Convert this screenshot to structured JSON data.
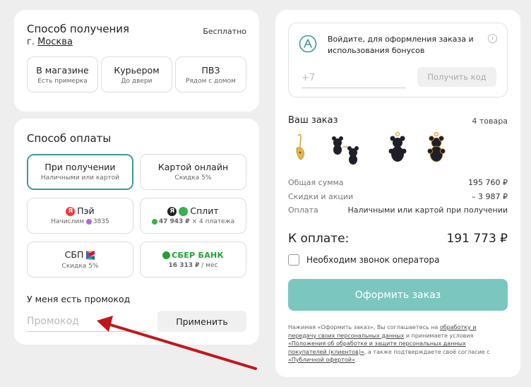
{
  "delivery": {
    "title": "Способ получения",
    "city_prefix": "г.",
    "city": "Москва",
    "price": "Бесплатно",
    "options": [
      {
        "title": "В магазине",
        "sub": "Есть примерка"
      },
      {
        "title": "Курьером",
        "sub": "До двери"
      },
      {
        "title": "ПВЗ",
        "sub": "Рядом с домом"
      }
    ]
  },
  "payment": {
    "title": "Способ оплаты",
    "on_receipt": {
      "title": "При получении",
      "sub": "Наличными или картой"
    },
    "card_online": {
      "title": "Картой онлайн",
      "sub": "Скидка 5%"
    },
    "yapay": {
      "title": "Пэй",
      "sub_prefix": "Начислим",
      "sub_value": "3835"
    },
    "split": {
      "title": "Сплит",
      "sub_value": "47 943 ₽",
      "sub_suffix": "× 4 платежа"
    },
    "sbp": {
      "title": "СБП",
      "sub": "Скидка 5%"
    },
    "sber": {
      "title": "СБЕР БАНК",
      "sub_value": "16 313 ₽",
      "sub_suffix": "/ мес"
    }
  },
  "promo": {
    "title": "У меня есть промокод",
    "placeholder": "Промокод",
    "button": "Применить"
  },
  "login": {
    "text": "Войдите, для оформления заказа и использования бонусов",
    "phone_placeholder": "+7",
    "code_button": "Получить код",
    "info": "i"
  },
  "order": {
    "title": "Ваш заказ",
    "count": "4 товара",
    "rows": [
      {
        "label": "Общая сумма",
        "value": "195 760 ₽"
      },
      {
        "label": "Скидки и акции",
        "value": "– 3 987 ₽"
      },
      {
        "label": "Оплата",
        "value": "Наличными или картой при получении"
      }
    ],
    "total_label": "К оплате:",
    "total_value": "191 773 ₽",
    "operator_call": "Необходим звонок оператора",
    "submit": "Оформить заказ"
  },
  "legal": {
    "part1": "Нажимая «Оформить заказ», Вы соглашаетесь на ",
    "link1": "обработку и передачу своих персональных данных",
    "part2": " и принимаете условия ",
    "link2": "«Положения об обработке и защите персональных данных покупателей (клиентов)»",
    "part3": ", а также подтверждаете своё согласие с ",
    "link3": "«Публичной офертой»",
    "part4": "."
  },
  "colors": {
    "accent": "#3a9a98",
    "button_disabled": "#7cc6c0",
    "arrow": "#c0171c",
    "yandex": "#ff3333",
    "sber": "#21a038"
  }
}
